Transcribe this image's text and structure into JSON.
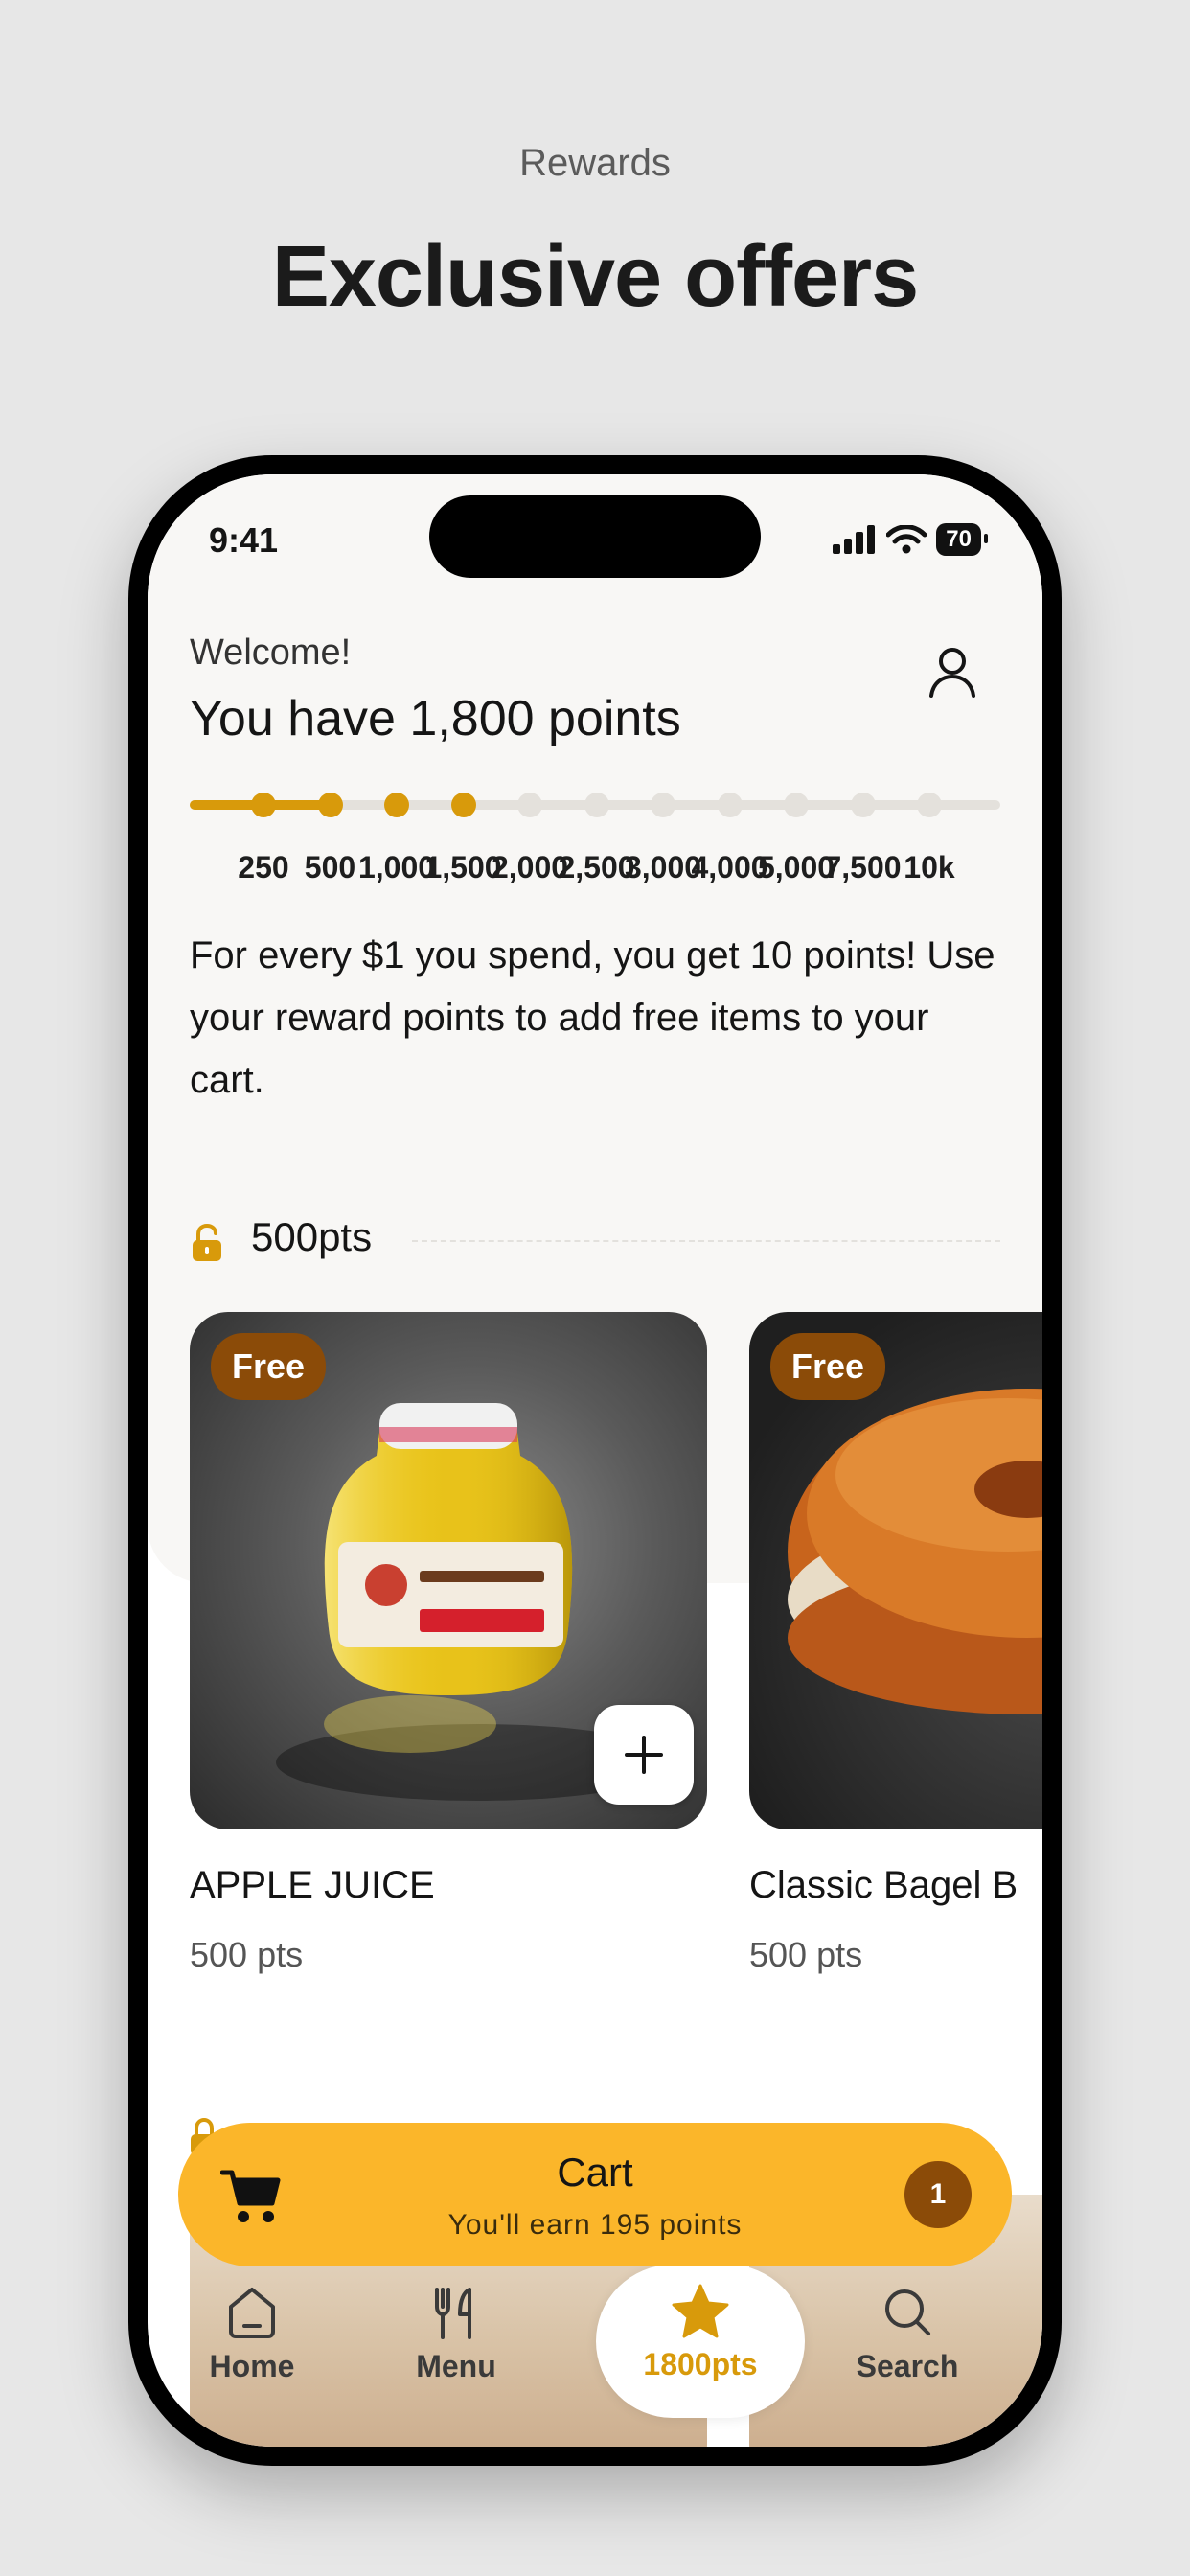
{
  "promo": {
    "subtitle": "Rewards",
    "title": "Exclusive offers"
  },
  "status_bar": {
    "time": "9:41",
    "battery": "70"
  },
  "header": {
    "welcome": "Welcome!",
    "points_line": "You have 1,800 points",
    "progress_value": 1800,
    "milestones": [
      "250",
      "500",
      "1,000",
      "1,500",
      "2,000",
      "2,500",
      "3,000",
      "4,000",
      "5,000",
      "7,500",
      "10k"
    ],
    "milestones_reached": 4,
    "description": "For every $1 you spend, you get 10 points! Use your reward points to add free items to your cart."
  },
  "section": {
    "label": "500pts",
    "icon": "unlock-icon"
  },
  "products": [
    {
      "badge": "Free",
      "name": "APPLE JUICE",
      "price": "500 pts",
      "image": "apple-juice-bottle"
    },
    {
      "badge": "Free",
      "name": "Classic Bagel B",
      "price": "500 pts",
      "image": "bagel"
    }
  ],
  "cart": {
    "title": "Cart",
    "subtitle": "You'll earn 195 points",
    "count": "1",
    "icon": "cart-icon"
  },
  "nav": {
    "items": [
      {
        "label": "Home",
        "icon": "home-icon"
      },
      {
        "label": "Menu",
        "icon": "fork-knife-icon"
      },
      {
        "label": "1800pts",
        "icon": "star-icon",
        "active": true
      },
      {
        "label": "Search",
        "icon": "search-icon"
      }
    ]
  },
  "colors": {
    "accent": "#d89a0b",
    "cart_bg": "#fbb62a",
    "badge_bg": "#8b4b08",
    "panel_bg": "#f8f7f5"
  }
}
